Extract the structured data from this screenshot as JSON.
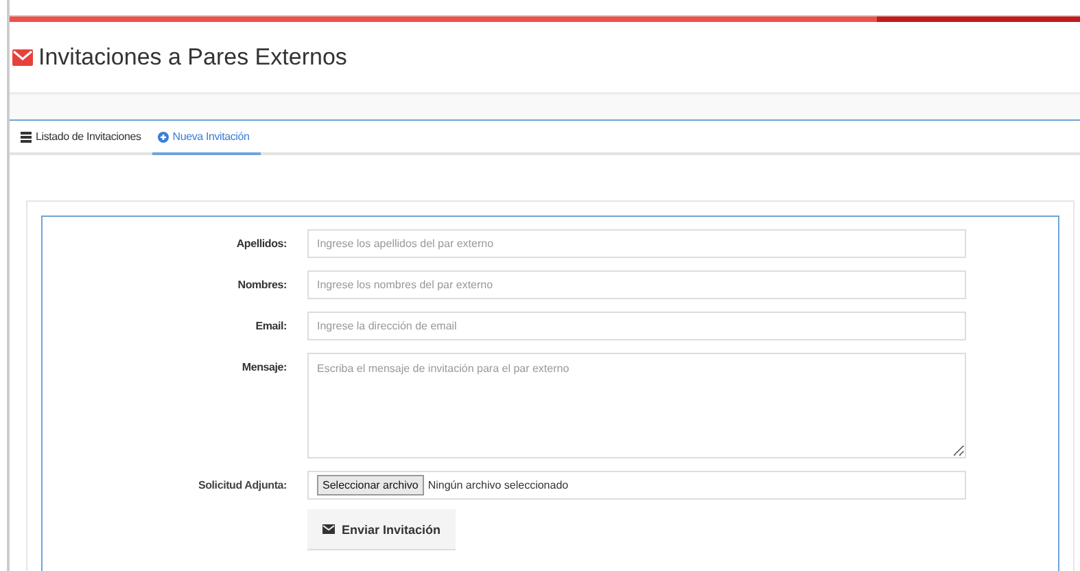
{
  "header": {
    "title": "Invitaciones a Pares Externos"
  },
  "tabs": [
    {
      "label": "Listado de Invitaciones",
      "kind": "list",
      "selected": false
    },
    {
      "label": "Nueva Invitación",
      "kind": "plus",
      "selected": true
    }
  ],
  "form": {
    "fields": [
      {
        "label": "Apellidos:",
        "kind": "input",
        "placeholder": "Ingrese los apellidos del par externo"
      },
      {
        "label": "Nombres:",
        "kind": "input",
        "placeholder": "Ingrese los nombres del par externo"
      },
      {
        "label": "Email:",
        "kind": "input",
        "placeholder": "Ingrese la dirección de email"
      },
      {
        "label": "Mensaje:",
        "kind": "textarea",
        "placeholder": "Escriba el mensaje de invitación para el par externo"
      },
      {
        "label": "Solicitud Adjunta:",
        "kind": "file",
        "button": "Seleccionar archivo",
        "status": "Ningún archivo seleccionado"
      }
    ],
    "submit": "Enviar Invitación"
  }
}
